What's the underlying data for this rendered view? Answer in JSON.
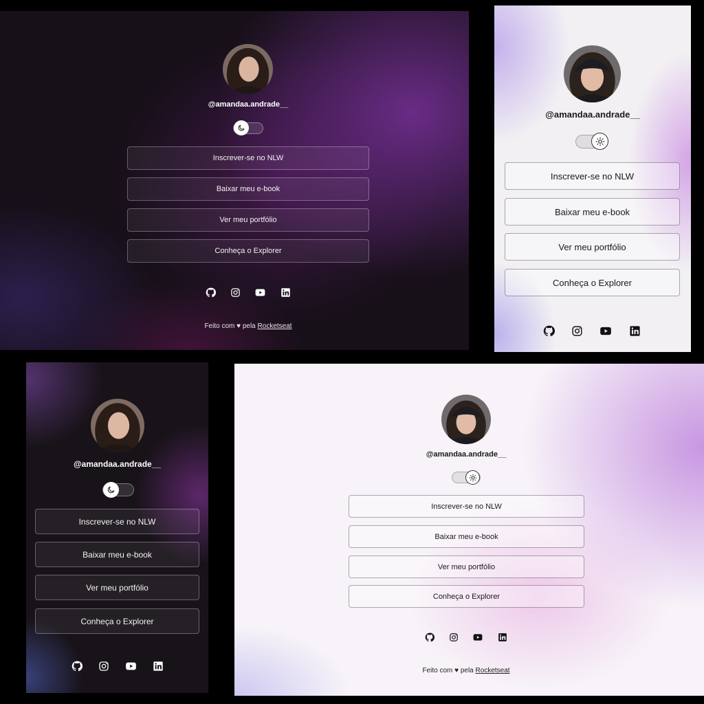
{
  "profile": {
    "handle": "@amandaa.andrade__"
  },
  "links": [
    {
      "label": "Inscrever-se no NLW"
    },
    {
      "label": "Baixar meu e-book"
    },
    {
      "label": "Ver meu portfólio"
    },
    {
      "label": "Conheça o Explorer"
    }
  ],
  "social": [
    "github-icon",
    "instagram-icon",
    "youtube-icon",
    "linkedin-icon"
  ],
  "footer": {
    "prefix": "Feito com ♥ pela",
    "brand": "Rocketseat"
  },
  "theme": {
    "dark_mode_toggle": "moon-icon",
    "light_mode_toggle": "sun-icon"
  }
}
